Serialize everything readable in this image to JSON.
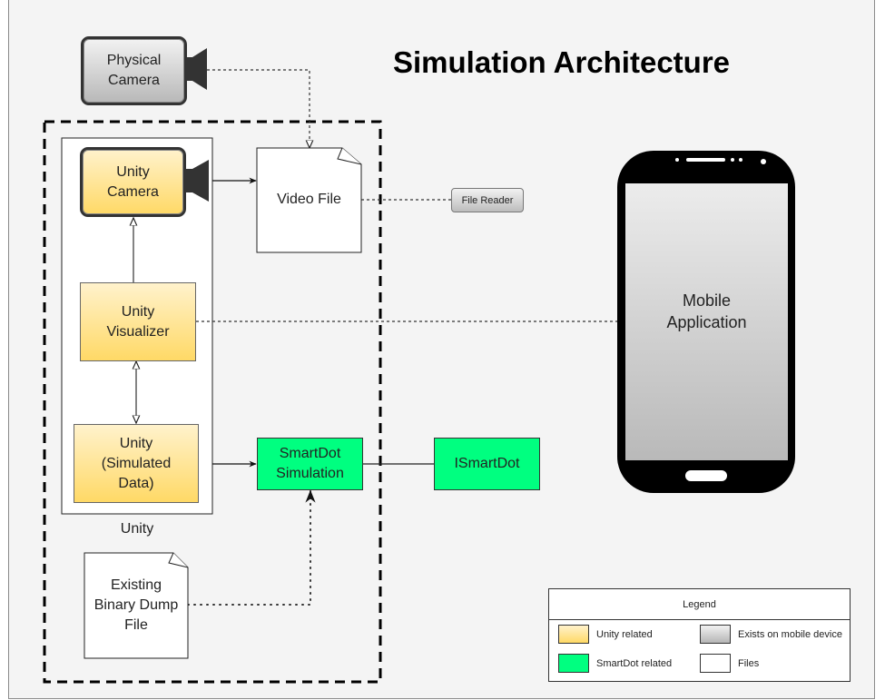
{
  "title": "Simulation Architecture",
  "nodes": {
    "physical_camera": "Physical\nCamera",
    "unity_camera": "Unity\nCamera",
    "video_file": "Video File",
    "file_reader": "File Reader",
    "unity_visualizer": "Unity\nVisualizer",
    "unity_simulated_data": "Unity\n(Simulated\nData)",
    "smartdot_simulation": "SmartDot\nSimulation",
    "ismartdot": "ISmartDot",
    "binary_dump": "Existing\nBinary Dump\nFile",
    "mobile_application": "Mobile\nApplication"
  },
  "groups": {
    "unity": "Unity"
  },
  "legend": {
    "title": "Legend",
    "items": [
      {
        "label": "Unity related",
        "color": "#ffd966"
      },
      {
        "label": "Exists on mobile device",
        "color": "#c0c0c0"
      },
      {
        "label": "SmartDot related",
        "color": "#00ff80"
      },
      {
        "label": "Files",
        "color": "#ffffff"
      }
    ]
  },
  "colors": {
    "unity": "#ffd966",
    "smartdot": "#00ff80",
    "background": "#f4f4f4"
  }
}
